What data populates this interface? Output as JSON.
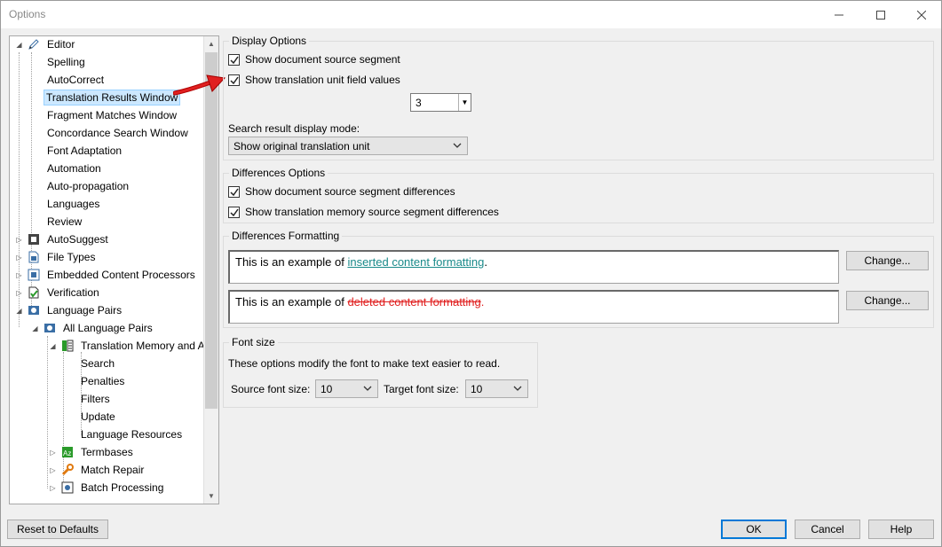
{
  "window": {
    "title": "Options"
  },
  "tree": {
    "items": [
      {
        "label": "Editor",
        "icon": "pencil-icon"
      },
      {
        "label": "Spelling"
      },
      {
        "label": "AutoCorrect"
      },
      {
        "label": "Translation Results Window",
        "selected": true
      },
      {
        "label": "Fragment Matches Window"
      },
      {
        "label": "Concordance Search Window"
      },
      {
        "label": "Font Adaptation"
      },
      {
        "label": "Automation"
      },
      {
        "label": "Auto-propagation"
      },
      {
        "label": "Languages"
      },
      {
        "label": "Review"
      },
      {
        "label": "AutoSuggest",
        "icon": "autosuggest-icon"
      },
      {
        "label": "File Types",
        "icon": "file-types-icon"
      },
      {
        "label": "Embedded Content Processors",
        "icon": "embedded-content-icon"
      },
      {
        "label": "Verification",
        "icon": "verification-icon"
      },
      {
        "label": "Language Pairs",
        "icon": "language-pairs-icon"
      },
      {
        "label": "All Language Pairs",
        "icon": "language-pair-icon"
      },
      {
        "label": "Translation Memory and A",
        "icon": "translation-memory-icon"
      },
      {
        "label": "Search"
      },
      {
        "label": "Penalties"
      },
      {
        "label": "Filters"
      },
      {
        "label": "Update"
      },
      {
        "label": "Language Resources"
      },
      {
        "label": "Termbases",
        "icon": "termbase-icon"
      },
      {
        "label": "Match Repair",
        "icon": "wrench-icon"
      },
      {
        "label": "Batch Processing",
        "icon": "batch-processing-icon"
      }
    ]
  },
  "display_options": {
    "title": "Display Options",
    "show_source_segment": {
      "label": "Show document source segment",
      "checked": true
    },
    "show_tu_field_values": {
      "label": "Show translation unit field values",
      "checked": true
    },
    "field_count": "3",
    "search_mode_label": "Search result display mode:",
    "search_mode_value": "Show original translation unit"
  },
  "differences_options": {
    "title": "Differences Options",
    "source_diff": {
      "label": "Show document source segment differences",
      "checked": true
    },
    "tm_diff": {
      "label": "Show translation memory source segment differences",
      "checked": true
    }
  },
  "differences_formatting": {
    "title": "Differences Formatting",
    "inserted_prefix": "This is an example of ",
    "inserted_text": "inserted content formatting",
    "inserted_suffix": ".",
    "deleted_prefix": "This is an example of ",
    "deleted_text": "deleted content formatting",
    "deleted_suffix": ".",
    "change_label": "Change...",
    "inserted_color": "#1a8a8a",
    "deleted_color": "#e02020"
  },
  "font_size": {
    "title": "Font size",
    "description": "These options modify the font to make text easier to read.",
    "source_label": "Source font size:",
    "source_value": "10",
    "target_label": "Target font size:",
    "target_value": "10"
  },
  "footer": {
    "reset_label": "Reset to Defaults",
    "ok_label": "OK",
    "cancel_label": "Cancel",
    "help_label": "Help"
  }
}
